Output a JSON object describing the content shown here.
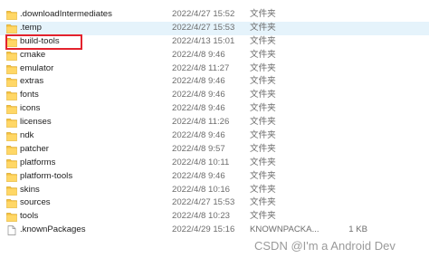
{
  "files": [
    {
      "name": ".downloadIntermediates",
      "date": "2022/4/27 15:52",
      "type": "文件夹",
      "size": "",
      "icon": "folder-icon"
    },
    {
      "name": ".temp",
      "date": "2022/4/27 15:53",
      "type": "文件夹",
      "size": "",
      "icon": "folder-icon",
      "hover": true
    },
    {
      "name": "build-tools",
      "date": "2022/4/13 15:01",
      "type": "文件夹",
      "size": "",
      "icon": "folder-icon"
    },
    {
      "name": "cmake",
      "date": "2022/4/8 9:46",
      "type": "文件夹",
      "size": "",
      "icon": "folder-icon"
    },
    {
      "name": "emulator",
      "date": "2022/4/8 11:27",
      "type": "文件夹",
      "size": "",
      "icon": "folder-icon"
    },
    {
      "name": "extras",
      "date": "2022/4/8 9:46",
      "type": "文件夹",
      "size": "",
      "icon": "folder-icon"
    },
    {
      "name": "fonts",
      "date": "2022/4/8 9:46",
      "type": "文件夹",
      "size": "",
      "icon": "folder-icon"
    },
    {
      "name": "icons",
      "date": "2022/4/8 9:46",
      "type": "文件夹",
      "size": "",
      "icon": "folder-icon"
    },
    {
      "name": "licenses",
      "date": "2022/4/8 11:26",
      "type": "文件夹",
      "size": "",
      "icon": "folder-icon"
    },
    {
      "name": "ndk",
      "date": "2022/4/8 9:46",
      "type": "文件夹",
      "size": "",
      "icon": "folder-icon"
    },
    {
      "name": "patcher",
      "date": "2022/4/8 9:57",
      "type": "文件夹",
      "size": "",
      "icon": "folder-icon"
    },
    {
      "name": "platforms",
      "date": "2022/4/8 10:11",
      "type": "文件夹",
      "size": "",
      "icon": "folder-icon"
    },
    {
      "name": "platform-tools",
      "date": "2022/4/8 9:46",
      "type": "文件夹",
      "size": "",
      "icon": "folder-icon"
    },
    {
      "name": "skins",
      "date": "2022/4/8 10:16",
      "type": "文件夹",
      "size": "",
      "icon": "folder-icon"
    },
    {
      "name": "sources",
      "date": "2022/4/27 15:53",
      "type": "文件夹",
      "size": "",
      "icon": "folder-icon"
    },
    {
      "name": "tools",
      "date": "2022/4/8 10:23",
      "type": "文件夹",
      "size": "",
      "icon": "folder-icon"
    },
    {
      "name": ".knownPackages",
      "date": "2022/4/29 15:16",
      "type": "KNOWNPACKA...",
      "size": "1 KB",
      "icon": "file-icon"
    }
  ],
  "watermark": "CSDN @I'm a Android Dev",
  "colors": {
    "highlight_border": "#e3222d",
    "hover_row": "#e5f3fb",
    "folder": "#f5c242"
  }
}
